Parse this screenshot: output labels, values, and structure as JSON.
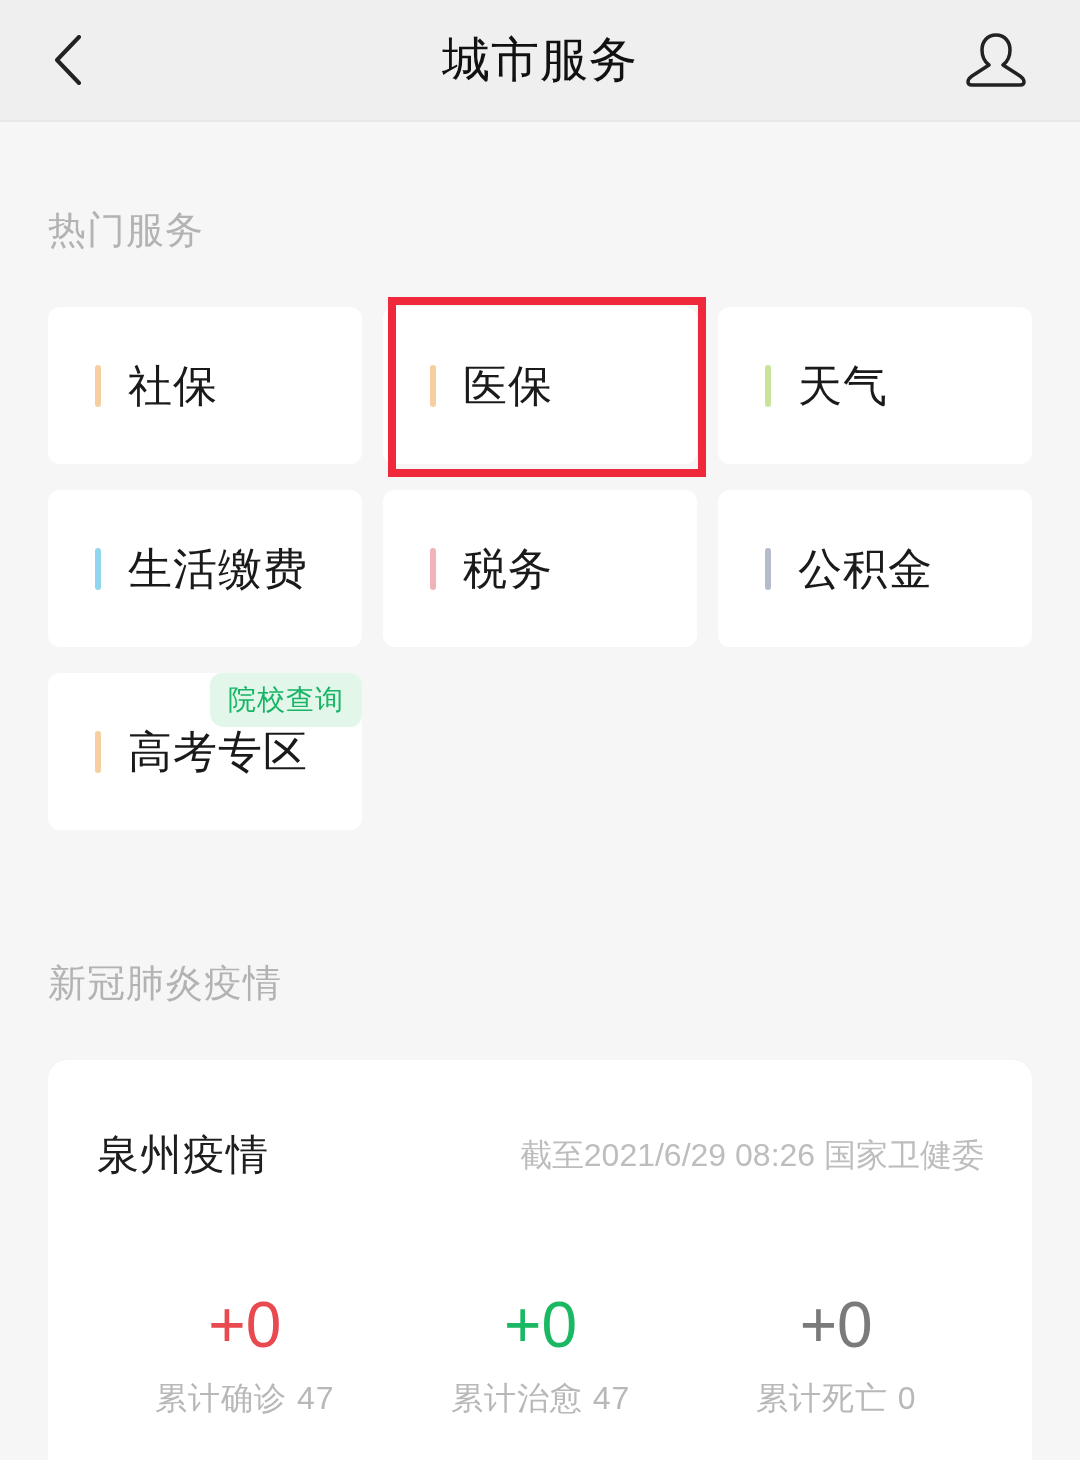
{
  "header": {
    "title": "城市服务"
  },
  "hot_services": {
    "title": "热门服务",
    "items": [
      {
        "label": "社保",
        "color": "#f5cfa0",
        "highlighted": false
      },
      {
        "label": "医保",
        "color": "#f5cfa0",
        "highlighted": true
      },
      {
        "label": "天气",
        "color": "#c8e39a",
        "highlighted": false
      },
      {
        "label": "生活缴费",
        "color": "#8fd6ee",
        "highlighted": false
      },
      {
        "label": "税务",
        "color": "#f2b3b8",
        "highlighted": false
      },
      {
        "label": "公积金",
        "color": "#b4bccb",
        "highlighted": false
      },
      {
        "label": "高考专区",
        "color": "#f5cfa0",
        "highlighted": false,
        "badge": "院校查询"
      }
    ]
  },
  "covid": {
    "title": "新冠肺炎疫情",
    "card": {
      "title": "泉州疫情",
      "source": "截至2021/6/29 08:26 国家卫健委",
      "stats": [
        {
          "value": "+0",
          "label": "累计确诊 47",
          "color": "#e84a50"
        },
        {
          "value": "+0",
          "label": "累计治愈 47",
          "color": "#1ab862"
        },
        {
          "value": "+0",
          "label": "累计死亡 0",
          "color": "#7a7a7a"
        }
      ]
    }
  }
}
